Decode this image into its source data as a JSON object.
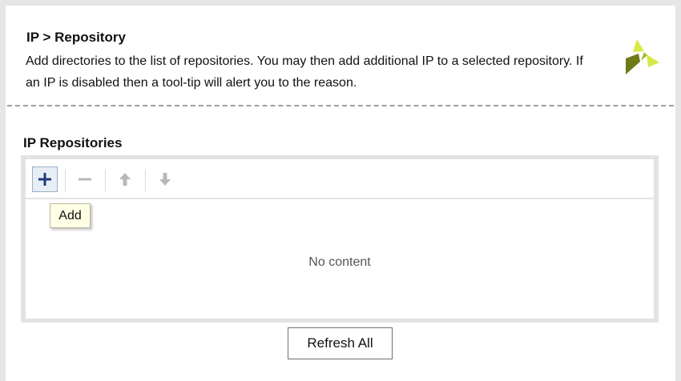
{
  "header": {
    "title": "IP > Repository",
    "description": "Add directories to the list of repositories. You may then add additional IP to a selected repository. If an IP is disabled then a tool-tip will alert you to the reason."
  },
  "repositories": {
    "section_title": "IP Repositories",
    "toolbar": {
      "add_icon": "plus-icon",
      "remove_icon": "minus-icon",
      "move_up_icon": "arrow-up-icon",
      "move_down_icon": "arrow-down-icon"
    },
    "tooltip": "Add",
    "empty_text": "No content"
  },
  "footer": {
    "refresh_label": "Refresh All"
  },
  "colors": {
    "accent_icon": "#1f3d7a",
    "disabled_icon": "#b8b8b8",
    "logo_light": "#d8e84a",
    "logo_dark": "#6e7a18"
  }
}
